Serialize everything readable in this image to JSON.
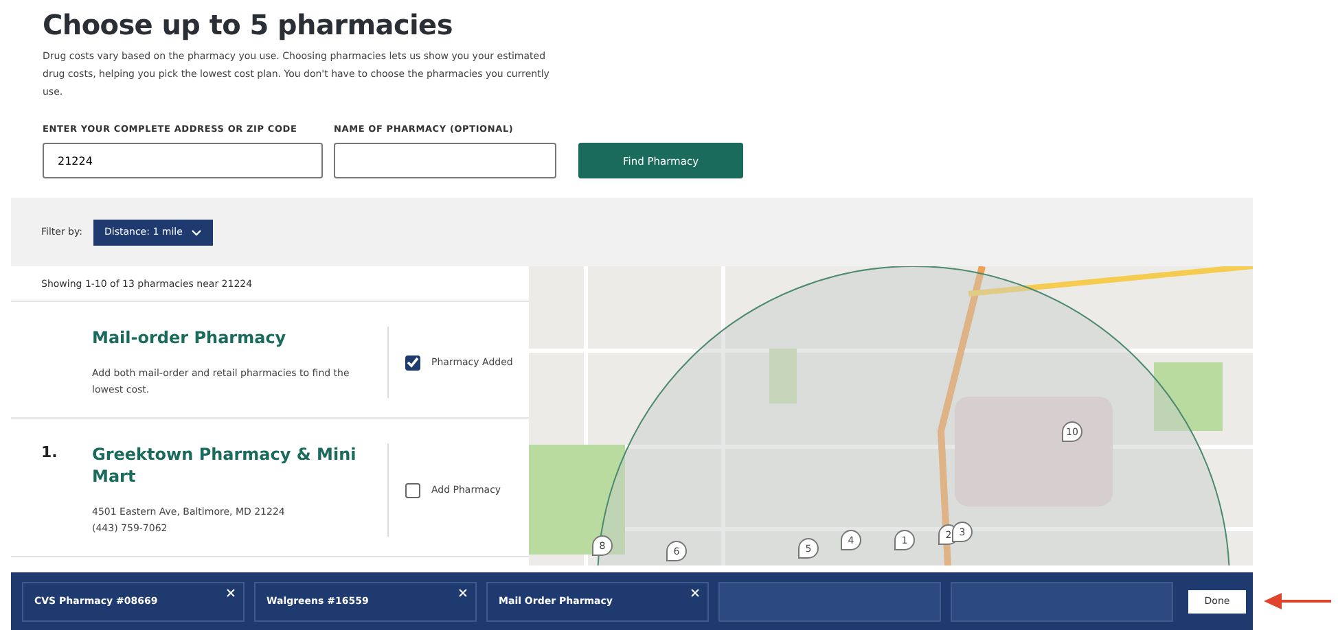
{
  "header": {
    "title": "Choose up to 5 pharmacies",
    "description": "Drug costs vary based on the pharmacy you use. Choosing pharmacies lets us show you your estimated drug costs, helping you pick the lowest cost plan. You don't have to choose the pharmacies you currently use."
  },
  "search": {
    "address_label": "ENTER YOUR COMPLETE ADDRESS OR ZIP CODE",
    "address_value": "21224",
    "name_label": "NAME OF PHARMACY (OPTIONAL)",
    "button": "Find Pharmacy"
  },
  "filter": {
    "label": "Filter by:",
    "dropdown": "Distance: 1 mile"
  },
  "results": {
    "summary": "Showing 1-10 of 13 pharmacies near 21224",
    "items": [
      {
        "kind": "mail",
        "name": "Mail-order Pharmacy",
        "description": "Add both mail-order and retail pharmacies to find the lowest cost.",
        "action": "Pharmacy Added",
        "checked": true
      },
      {
        "kind": "retail",
        "number": "1.",
        "name": "Greektown Pharmacy & Mini Mart",
        "address": "4501 Eastern Ave, Baltimore, MD 21224",
        "phone": "(443) 759-7062",
        "action": "Add Pharmacy",
        "checked": false
      }
    ]
  },
  "map": {
    "markers": [
      "10",
      "8",
      "6",
      "5",
      "4",
      "1",
      "2",
      "3"
    ]
  },
  "selection_bar": {
    "slots": [
      {
        "label": "CVS Pharmacy #08669",
        "filled": true
      },
      {
        "label": "Walgreens #16559",
        "filled": true
      },
      {
        "label": "Mail Order Pharmacy",
        "filled": true
      },
      {
        "filled": false
      },
      {
        "filled": false
      }
    ],
    "done": "Done"
  }
}
